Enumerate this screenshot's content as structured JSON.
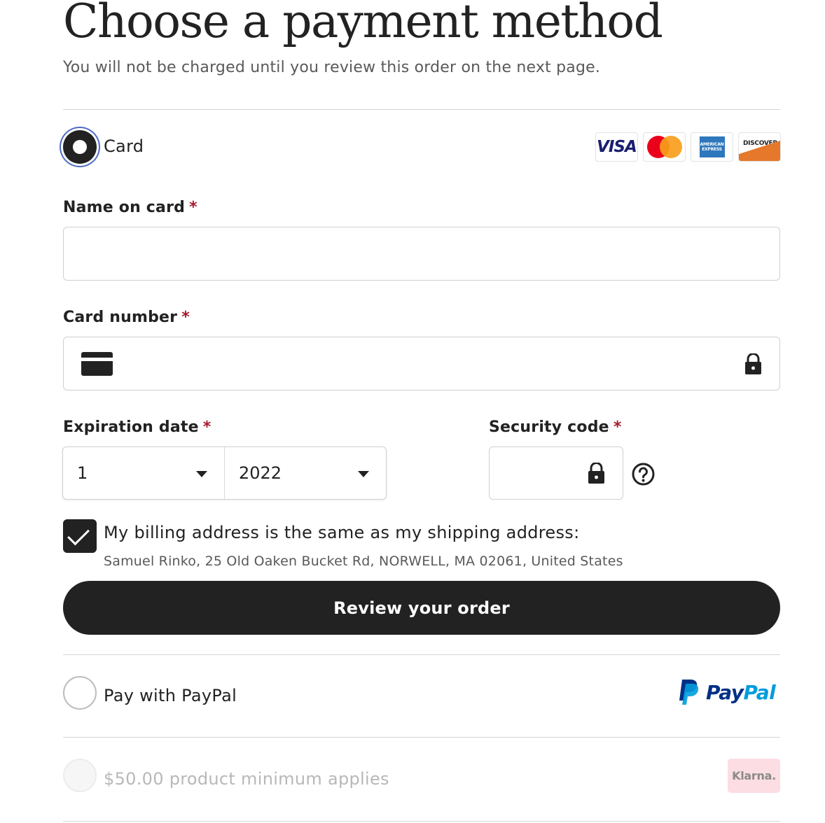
{
  "header": {
    "title": "Choose a payment method",
    "subtitle": "You will not be charged until you review this order on the next page."
  },
  "card_option": {
    "label": "Card",
    "selected": true,
    "logos": {
      "visa": "VISA",
      "amex_line1": "AMERICAN",
      "amex_line2": "EXPRESS",
      "discover": "DISCOVER"
    }
  },
  "form": {
    "name_label": "Name on card",
    "name_value": "",
    "card_number_label": "Card number",
    "card_number_value": "",
    "expiration_label": "Expiration date",
    "exp_month": "1",
    "exp_year": "2022",
    "security_label": "Security code",
    "security_value": "",
    "required_mark": "*"
  },
  "billing": {
    "label": "My billing address is the same as my shipping address:",
    "address": "Samuel Rinko, 25 Old Oaken Bucket Rd, NORWELL, MA 02061, United States",
    "checked": true
  },
  "actions": {
    "review_label": "Review your order"
  },
  "paypal_option": {
    "label": "Pay with PayPal",
    "logo_pay": "Pay",
    "logo_pal": "Pal"
  },
  "klarna_option": {
    "label": "$50.00 product minimum applies",
    "logo": "Klarna."
  },
  "colors": {
    "primary": "#222222",
    "focus_ring": "#4d6bc6",
    "required": "#a61a2e",
    "paypal_dark": "#003087",
    "paypal_light": "#009cde",
    "klarna_bg": "#fcdde3"
  }
}
